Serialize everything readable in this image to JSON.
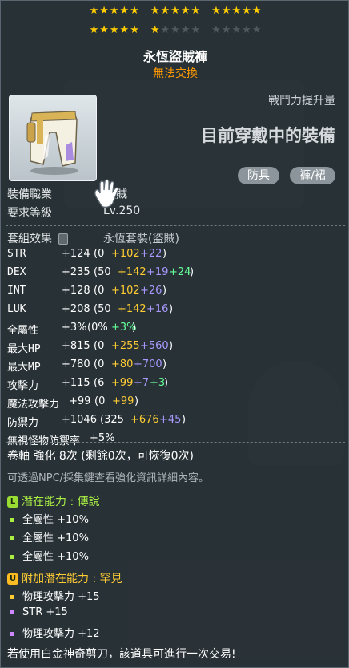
{
  "stars": {
    "rows": [
      [
        [
          true,
          true,
          true,
          true,
          true
        ],
        [
          true,
          true,
          true,
          true,
          true
        ],
        [
          true,
          true,
          true,
          true,
          true
        ]
      ],
      [
        [
          true,
          true,
          true,
          true,
          true
        ],
        [
          true,
          false,
          false,
          false,
          false
        ],
        [
          false,
          false,
          false,
          false,
          false
        ]
      ]
    ],
    "filled_count": 21,
    "total": 30,
    "on_color": "#ffcc00",
    "off_color": "#505860"
  },
  "item": {
    "name": "永恆盜賊褲",
    "trade_status": "無法交換",
    "icon": "pants-icon"
  },
  "compare": {
    "power_label": "戰鬥力提升量",
    "equipped_title": "目前穿戴中的裝備"
  },
  "tags": [
    "防具",
    "褲/裙"
  ],
  "requirements": {
    "job_label": "裝備職業",
    "job_value": "盜賊",
    "level_label": "要求等級",
    "level_value": "Lv.250"
  },
  "set_effect": {
    "label": "套組效果",
    "set_name": "永恆套裝(盜賊)"
  },
  "stats": [
    {
      "name": "STR",
      "total": "+124",
      "open": "(0",
      "base": "0",
      "bonus": "+102",
      "extra": "+22",
      "star": "",
      "close": ")"
    },
    {
      "name": "DEX",
      "total": "+235",
      "open": "(50",
      "base": "50",
      "bonus": "+142",
      "extra": "+19",
      "star": "+24",
      "close": ")"
    },
    {
      "name": "INT",
      "total": "+128",
      "open": "(0",
      "base": "0",
      "bonus": "+102",
      "extra": "+26",
      "star": "",
      "close": ")"
    },
    {
      "name": "LUK",
      "total": "+208",
      "open": "(50",
      "base": "50",
      "bonus": "+142",
      "extra": "+16",
      "star": "",
      "close": ")"
    },
    {
      "name": "全屬性",
      "total": "+3%",
      "open": "(0%",
      "base": "0%",
      "bonus": "",
      "extra": "",
      "star": "+3%",
      "close": ")"
    },
    {
      "name": "最大HP",
      "total": "+815",
      "open": "(0",
      "base": "0",
      "bonus": "+255",
      "extra": "+560",
      "star": "",
      "close": ")"
    },
    {
      "name": "最大MP",
      "total": "+780",
      "open": "(0",
      "base": "0",
      "bonus": "+80",
      "extra": "+700",
      "star": "",
      "close": ")"
    },
    {
      "name": "攻擊力",
      "total": "+115",
      "open": "(6",
      "base": "6",
      "bonus": "+99",
      "extra": "+7",
      "star": "+3",
      "close": ")"
    },
    {
      "name": "魔法攻擊力",
      "total": "+99",
      "open": "(0",
      "base": "0",
      "bonus": "+99",
      "extra": "",
      "star": "",
      "close": ")"
    },
    {
      "name": "防禦力",
      "total": "+1046",
      "open": "(325",
      "base": "325",
      "bonus": "+676",
      "extra": "+45",
      "star": "",
      "close": ")"
    },
    {
      "name": "無視怪物防禦率",
      "total": "+5%",
      "open": "",
      "base": "",
      "bonus": "",
      "extra": "",
      "star": "",
      "close": ""
    }
  ],
  "scroll": {
    "text": "卷軸 強化 8次 (剩餘0次，可恢復0次)"
  },
  "note": "可透過NPC/採集鍵查看強化資訊詳細內容。",
  "potential": {
    "badge": "L",
    "badge_color": "#99dd33",
    "title": "潛在能力 : 傳說",
    "title_color": "#aaee44",
    "lines": [
      "全屬性 +10%",
      "全屬性 +10%",
      "全屬性 +10%"
    ]
  },
  "additional_potential": {
    "badge": "U",
    "badge_color": "#ffbb22",
    "title": "附加潛在能力 : 罕見",
    "title_color": "#ffcc33",
    "lines": [
      {
        "text": "物理攻擊力 +15",
        "bullet": "#ffcc33"
      },
      {
        "text": "STR +15",
        "bullet": "#cc88ff"
      },
      {
        "text": "物理攻擊力 +12",
        "bullet": "#cc88ff"
      }
    ]
  },
  "footer": "若使用白金神奇剪刀，該道具可進行一次交易!"
}
